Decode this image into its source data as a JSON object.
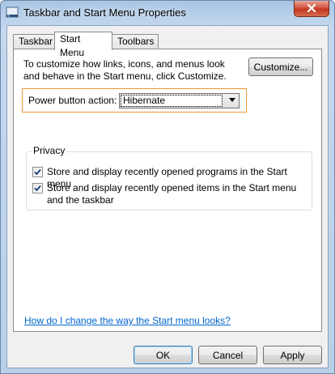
{
  "window": {
    "title": "Taskbar and Start Menu Properties",
    "icon": "taskbar-icon",
    "close_icon": "close-icon"
  },
  "tabs": [
    {
      "label": "Taskbar",
      "active": false
    },
    {
      "label": "Start Menu",
      "active": true
    },
    {
      "label": "Toolbars",
      "active": false
    }
  ],
  "start_menu": {
    "intro_text": "To customize how links, icons, and menus look and behave in the Start menu, click Customize.",
    "customize_label": "Customize...",
    "power_button": {
      "label": "Power button action:",
      "selected": "Hibernate"
    },
    "privacy": {
      "legend": "Privacy",
      "options": [
        {
          "label": "Store and display recently opened programs in the Start menu",
          "checked": true
        },
        {
          "label": "Store and display recently opened items in the Start menu and the taskbar",
          "checked": true
        }
      ]
    },
    "help_link": "How do I change the way the Start menu looks?"
  },
  "footer": {
    "ok_label": "OK",
    "cancel_label": "Cancel",
    "apply_label": "Apply"
  },
  "colors": {
    "highlight_border": "#f0963c",
    "link": "#0066cc",
    "close_button": "#c0381f"
  }
}
